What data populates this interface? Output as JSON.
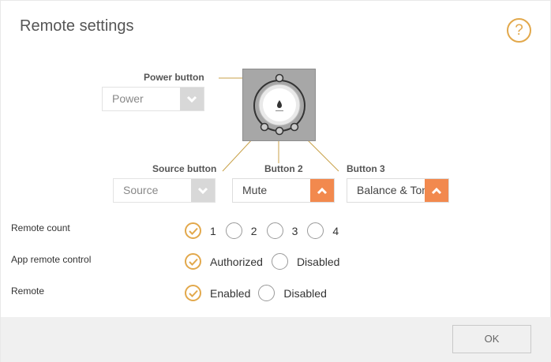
{
  "dialog": {
    "title": "Remote settings",
    "help_glyph": "?"
  },
  "device_map": {
    "power_button": {
      "label": "Power button",
      "value": "Power",
      "disabled": true
    },
    "source_button": {
      "label": "Source button",
      "value": "Source",
      "disabled": true
    },
    "button2": {
      "label": "Button 2",
      "value": "Mute",
      "disabled": false
    },
    "button3": {
      "label": "Button 3",
      "value": "Balance & Tone",
      "disabled": false
    }
  },
  "settings": {
    "remote_count": {
      "label": "Remote count",
      "options": [
        "1",
        "2",
        "3",
        "4"
      ],
      "selected": "1"
    },
    "app_remote_control": {
      "label": "App remote control",
      "options": [
        "Authorized",
        "Disabled"
      ],
      "selected": "Authorized"
    },
    "remote": {
      "label": "Remote",
      "options": [
        "Enabled",
        "Disabled"
      ],
      "selected": "Enabled"
    }
  },
  "footer": {
    "ok_label": "OK"
  },
  "colors": {
    "accent": "#e2a84b",
    "dropdown_active": "#f2894e",
    "dropdown_disabled": "#d8d8d8",
    "footer_bg": "#f0f0f0"
  }
}
